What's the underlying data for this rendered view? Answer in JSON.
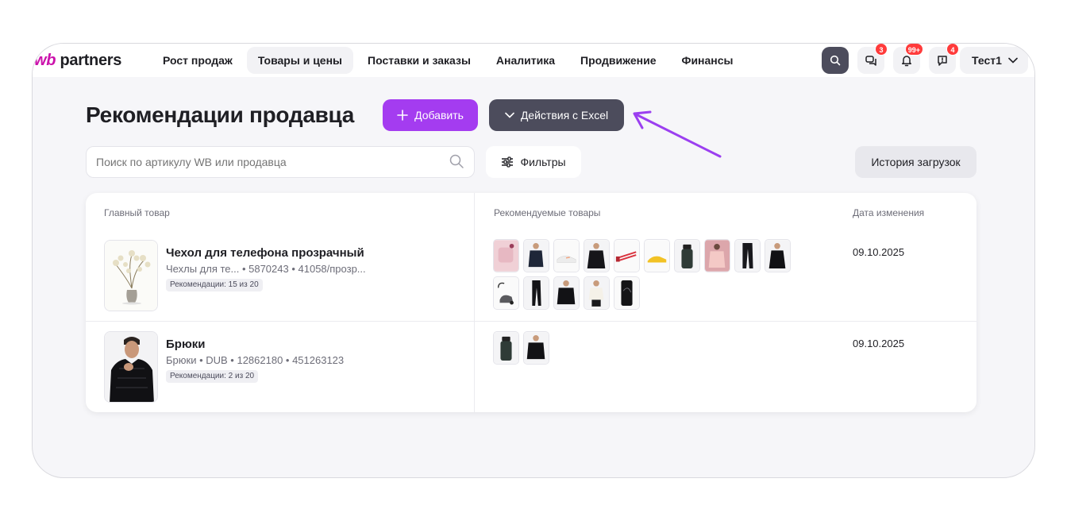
{
  "app": {
    "logo_prefix": "wb",
    "logo_suffix": "partners"
  },
  "nav": [
    {
      "label": "Рост продаж",
      "active": false
    },
    {
      "label": "Товары и цены",
      "active": true
    },
    {
      "label": "Поставки и заказы",
      "active": false
    },
    {
      "label": "Аналитика",
      "active": false
    },
    {
      "label": "Продвижение",
      "active": false
    },
    {
      "label": "Финансы",
      "active": false
    }
  ],
  "header_icons": {
    "search": "search-icon",
    "chat_badge": "3",
    "notifications_badge": "99+",
    "support_badge": "4"
  },
  "user": {
    "name": "Тест1"
  },
  "page": {
    "title": "Рекомендации продавца",
    "add_label": "Добавить",
    "excel_label": "Действия с Excel",
    "search_placeholder": "Поиск по артикулу WB или продавца",
    "filters_label": "Фильтры",
    "history_label": "История загрузок"
  },
  "table": {
    "headers": {
      "main": "Главный товар",
      "recommended": "Рекомендуемые товары",
      "date": "Дата изменения"
    },
    "rows": [
      {
        "name": "Чехол для телефона прозрачный",
        "meta": "Чехлы для те... • 5870243 • 41058/прозр...",
        "rec": "Рекомендации: 15 из 20",
        "date": "09.10.2025",
        "thumbs": [
          "pink-cushion",
          "man-jacket",
          "white-sneakers",
          "black-hoodie",
          "red-expander",
          "yellow-sneakers",
          "bottle",
          "pink-sweater",
          "black-pants",
          "black-coat",
          "vacuum-cleaner",
          "black-trousers",
          "black-parka",
          "white-shirt",
          "black-phone"
        ]
      },
      {
        "name": "Брюки",
        "meta": "Брюки • DUB • 12862180 • 451263123",
        "rec": "Рекомендации: 2 из 20",
        "date": "09.10.2025",
        "thumbs": [
          "bottle",
          "black-parka"
        ]
      }
    ]
  },
  "colors": {
    "accent": "#a43cf0",
    "dark_button": "#4c4c5c",
    "badge": "#ff3b3b",
    "brand": "#cb11ab"
  }
}
